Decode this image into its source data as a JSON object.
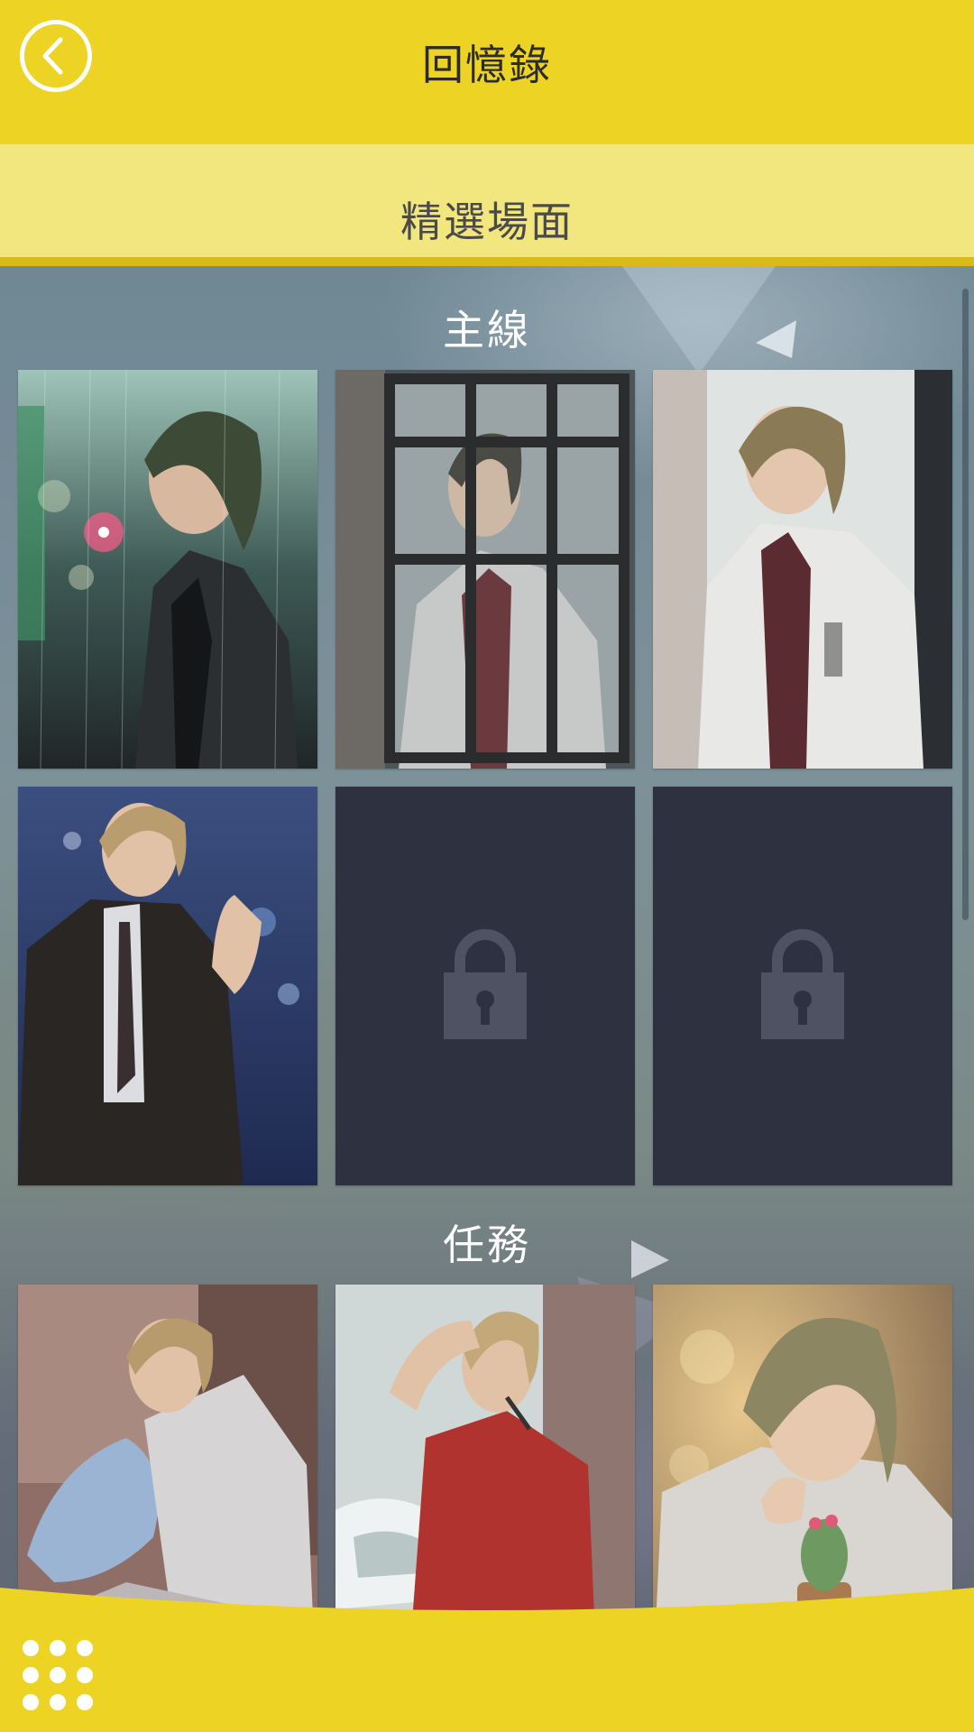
{
  "header": {
    "title": "回憶錄",
    "back_icon": "chevron-left-icon"
  },
  "subheader": {
    "title": "精選場面"
  },
  "sections": [
    {
      "title": "主線",
      "cards": [
        {
          "status": "unlocked",
          "scene": "rainy-city-street"
        },
        {
          "status": "unlocked",
          "scene": "rainy-window"
        },
        {
          "status": "unlocked",
          "scene": "leaning-on-wall"
        },
        {
          "status": "unlocked",
          "scene": "waving-in-suit"
        },
        {
          "status": "locked",
          "icon": "lock-icon"
        },
        {
          "status": "locked",
          "icon": "lock-icon"
        }
      ]
    },
    {
      "title": "任務",
      "cards": [
        {
          "status": "unlocked",
          "scene": "hugging-pillow"
        },
        {
          "status": "unlocked",
          "scene": "red-shirt-bathroom"
        },
        {
          "status": "unlocked",
          "scene": "holding-cactus"
        }
      ]
    }
  ],
  "footer": {
    "menu_icon": "grid-menu-icon"
  },
  "colors": {
    "accent_yellow": "#ecd324",
    "subheader_yellow": "#f2e67e",
    "locked_card": "#2d3140",
    "lock_glyph": "#4e5262"
  }
}
